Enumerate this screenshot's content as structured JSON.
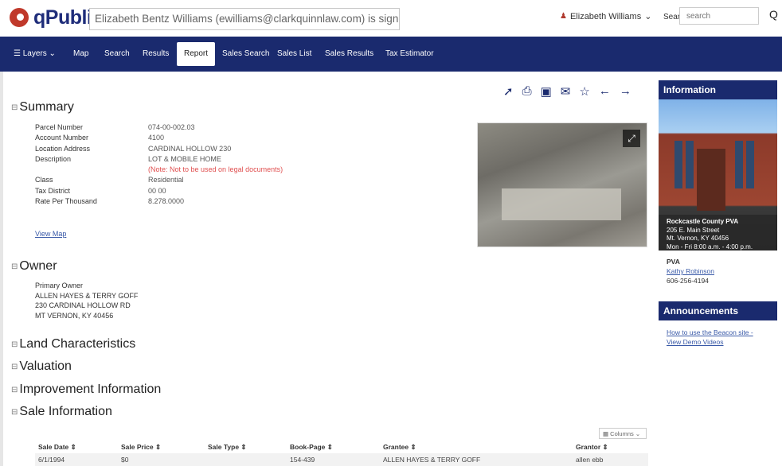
{
  "header": {
    "logo_text": "qPubli",
    "signed_in": "Elizabeth Bentz Williams (ewilliams@clarkquinnlaw.com) is signed in",
    "user_name": "Elizabeth Williams",
    "user_chevron": "⌄",
    "search_label": "Search",
    "search_placeholder": "search",
    "search_icon": "Q"
  },
  "nav": {
    "layers": "Layers",
    "items": [
      "Map",
      "Search",
      "Results",
      "Report",
      "Sales Search",
      "Sales List",
      "Sales Results",
      "Tax Estimator"
    ],
    "active": "Report"
  },
  "toolbar_icons": [
    "share-icon",
    "print-icon",
    "image-icon",
    "email-icon",
    "star-icon",
    "back-arrow-icon",
    "forward-arrow-icon"
  ],
  "sections": {
    "toggle_glyph": "⊟",
    "summary": "Summary",
    "owner": "Owner",
    "land": "Land Characteristics",
    "valuation": "Valuation",
    "improvement": "Improvement Information",
    "sale": "Sale Information"
  },
  "summary": {
    "labels": [
      "Parcel Number",
      "Account Number",
      "Location Address",
      "Description",
      "",
      "Class",
      "Tax District",
      "Rate Per Thousand"
    ],
    "values": [
      "074-00-002.03",
      "4100",
      "CARDINAL HOLLOW 230",
      "LOT & MOBILE HOME",
      "(Note: Not to be used on legal documents)",
      "Residential",
      "00 00",
      "8.278.0000"
    ],
    "view_map": "View Map"
  },
  "owner": {
    "label": "Primary Owner",
    "lines": [
      "ALLEN HAYES & TERRY GOFF",
      "230 CARDINAL HOLLOW RD",
      "MT VERNON, KY 40456"
    ]
  },
  "sidebar": {
    "information_title": "Information",
    "office_name": "Rockcastle County PVA",
    "office_street": "205 E. Main Street",
    "office_city": "Mt. Vernon, KY 40456",
    "office_hours": "Mon - Fri 8:00 a.m. - 4:00 p.m.",
    "pva_label": "PVA",
    "pva_name": "Kathy Robinson",
    "pva_phone": "606-256-4194",
    "announcements_title": "Announcements",
    "announcement_link": "How to use the Beacon site - View Demo Videos"
  },
  "sales_table": {
    "columns_button": "Columns",
    "headers": [
      "Sale Date ⇕",
      "Sale Price ⇕",
      "Sale Type ⇕",
      "Book-Page ⇕",
      "Grantee ⇕",
      "Grantor ⇕"
    ],
    "rows": [
      [
        "6/1/1994",
        "$0",
        "",
        "154-439",
        "ALLEN HAYES & TERRY GOFF",
        "allen ebb"
      ]
    ]
  },
  "colors": {
    "nav_bg": "#1a2a6e",
    "logo_red": "#c0392b",
    "note_red": "#e05050",
    "link_blue": "#3a5aa8"
  }
}
